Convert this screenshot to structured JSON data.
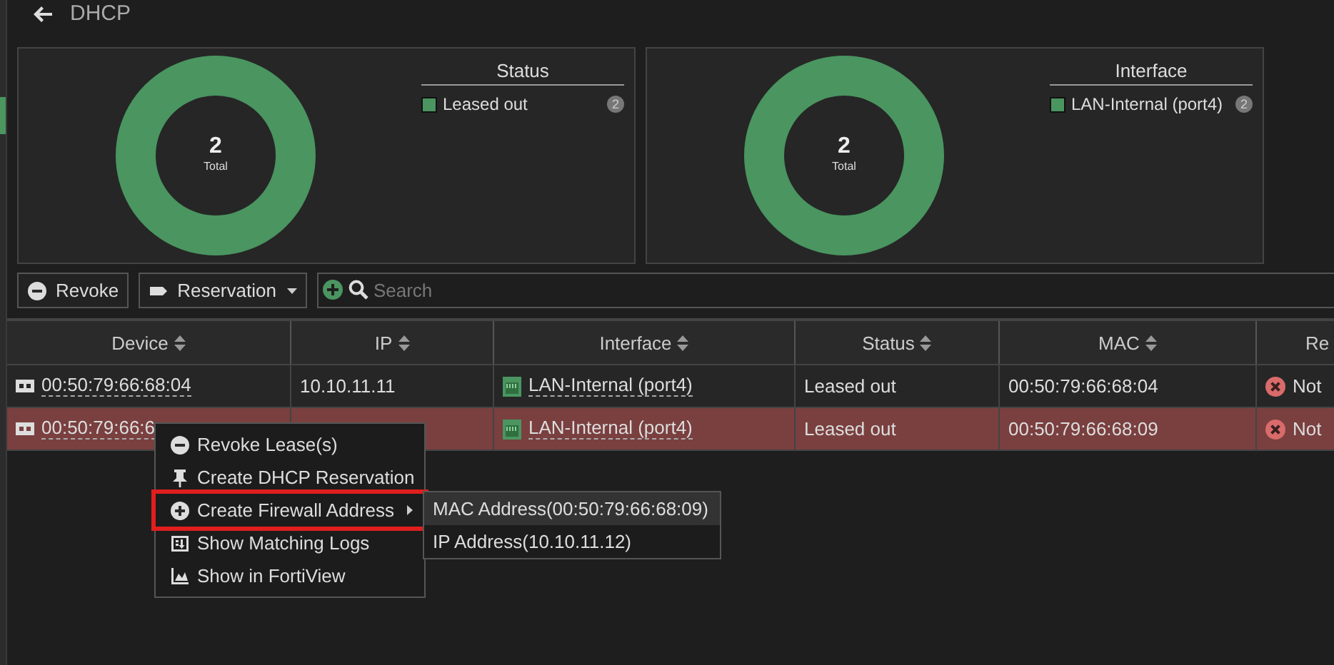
{
  "page": {
    "title": "DHCP"
  },
  "cards": [
    {
      "title": "Status",
      "total": "2",
      "total_label": "Total",
      "legend": [
        {
          "label": "Leased out",
          "count": "2",
          "color": "#4a9560"
        }
      ]
    },
    {
      "title": "Interface",
      "total": "2",
      "total_label": "Total",
      "legend": [
        {
          "label": "LAN-Internal (port4)",
          "count": "2",
          "color": "#4a9560"
        }
      ]
    }
  ],
  "toolbar": {
    "buttons": [
      {
        "kind": "revoke",
        "label": "Revoke"
      },
      {
        "kind": "reservation",
        "label": "Reservation"
      }
    ],
    "search": {
      "placeholder": "Search"
    }
  },
  "table": {
    "columns": [
      "Device",
      "IP",
      "Interface",
      "Status",
      "MAC",
      "Re"
    ],
    "rows": [
      {
        "selected": false,
        "device": "00:50:79:66:68:04",
        "ip": "10.10.11.11",
        "interface": "LAN-Internal (port4)",
        "status": "Leased out",
        "mac": "00:50:79:66:68:04",
        "column_6": "Not"
      },
      {
        "selected": true,
        "device": "00:50:79:66:6",
        "interface": "LAN-Internal (port4)",
        "status": "Leased out",
        "mac": "00:50:79:66:68:09",
        "column_6": "Not"
      }
    ]
  },
  "context_menu": {
    "items": [
      {
        "kind": "revoke",
        "label": "Revoke Lease(s)",
        "annotated": false
      },
      {
        "kind": "pin",
        "label": "Create DHCP Reservation",
        "annotated": false
      },
      {
        "kind": "add",
        "label": "Create Firewall Address",
        "annotated": true,
        "submenu": [
          {
            "label": "MAC Address(00:50:79:66:68:09)",
            "selected": true
          },
          {
            "label": "IP Address(10.10.11.12)",
            "selected": false
          }
        ]
      },
      {
        "kind": "logs",
        "label": "Show Matching Logs",
        "annotated": false
      },
      {
        "kind": "chart",
        "label": "Show in FortiView",
        "annotated": false
      }
    ]
  }
}
